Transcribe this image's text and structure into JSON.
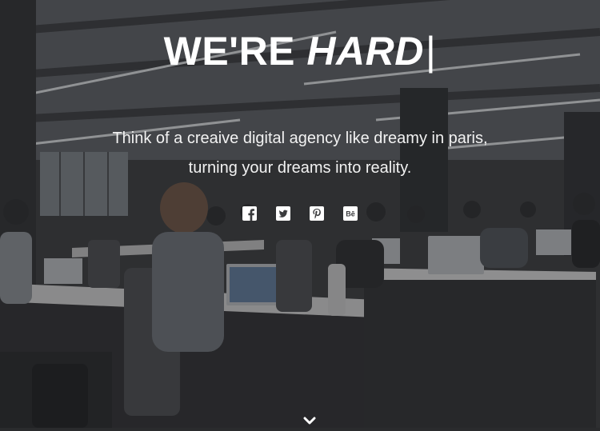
{
  "hero": {
    "title_prefix": "WE'RE ",
    "title_emphasis": "HARD",
    "title_cursor": "|",
    "tagline_line1": "Think of a creaive digital agency like dreamy in paris,",
    "tagline_line2": "turning your dreams into reality."
  },
  "social": {
    "items": [
      {
        "icon": "facebook-icon"
      },
      {
        "icon": "twitter-icon"
      },
      {
        "icon": "pinterest-icon"
      },
      {
        "icon": "behance-icon",
        "label": "Bē"
      }
    ]
  },
  "scroll_indicator": {
    "icon": "chevron-down-icon"
  },
  "colors": {
    "text": "#ffffff",
    "overlay": "#1e1f21"
  }
}
